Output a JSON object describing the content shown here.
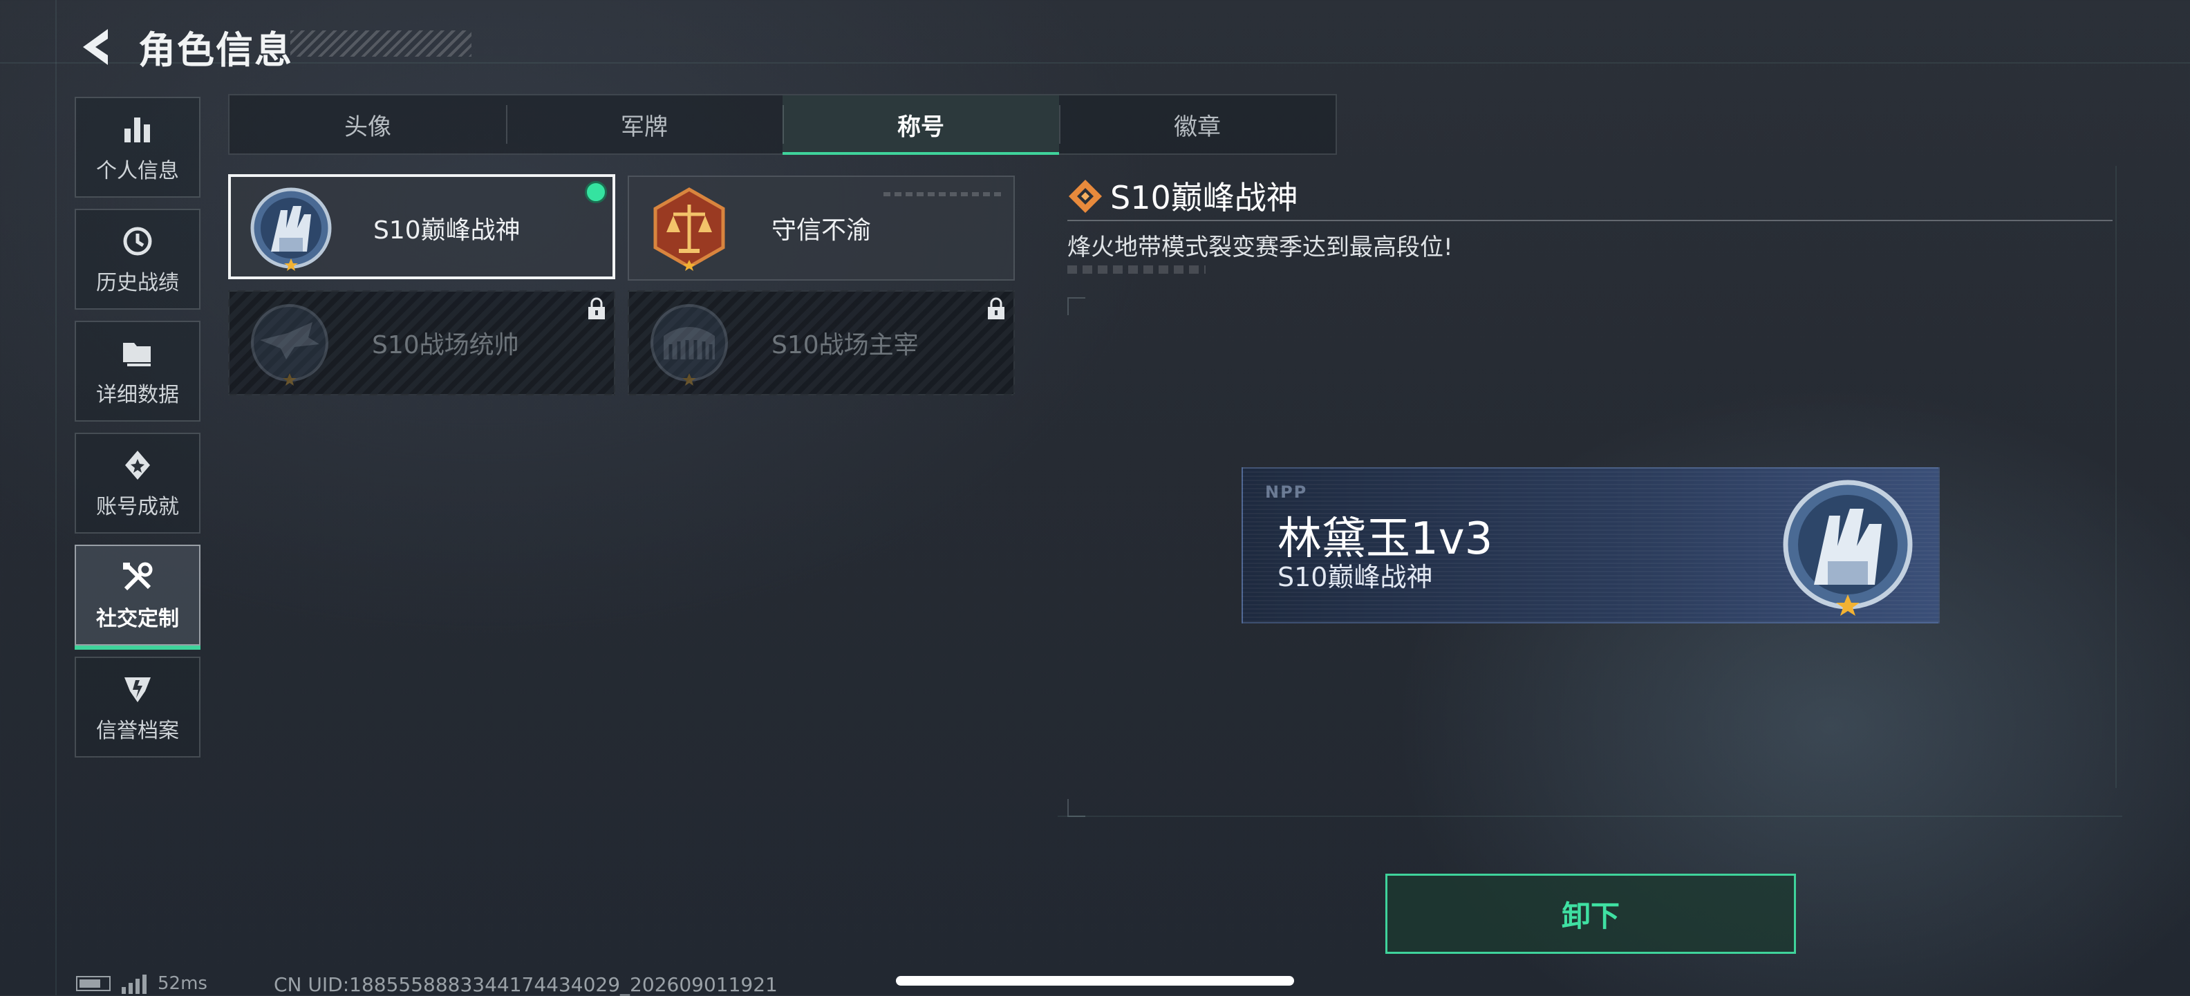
{
  "header": {
    "title": "角色信息"
  },
  "sidebar": {
    "items": [
      {
        "label": "个人信息",
        "icon": "bar-chart-icon"
      },
      {
        "label": "历史战绩",
        "icon": "history-icon"
      },
      {
        "label": "详细数据",
        "icon": "folder-icon"
      },
      {
        "label": "账号成就",
        "icon": "achievement-icon"
      },
      {
        "label": "社交定制",
        "icon": "tools-icon",
        "active": true
      },
      {
        "label": "信誉档案",
        "icon": "reputation-icon"
      }
    ]
  },
  "tabs": [
    {
      "label": "头像"
    },
    {
      "label": "军牌"
    },
    {
      "label": "称号",
      "active": true
    },
    {
      "label": "徽章"
    }
  ],
  "titles": [
    {
      "name": "S10巅峰战神",
      "state": "equipped"
    },
    {
      "name": "守信不渝",
      "state": "unlocked"
    },
    {
      "name": "S10战场统帅",
      "state": "locked"
    },
    {
      "name": "S10战场主宰",
      "state": "locked"
    }
  ],
  "detail": {
    "title": "S10巅峰战神",
    "description": "烽火地带模式裂变赛季达到最高段位!"
  },
  "preview": {
    "logo": "NPP",
    "player_name": "林黛玉1v3",
    "title": "S10巅峰战神"
  },
  "action": {
    "unequip_label": "卸下"
  },
  "status": {
    "ping": "52ms",
    "uid": "CN UID:1885558883344174434029_202609011921"
  },
  "colors": {
    "accent": "#3fd39b",
    "equipped_dot": "#35e3a0",
    "preview_bg": "#2b3b5a"
  }
}
